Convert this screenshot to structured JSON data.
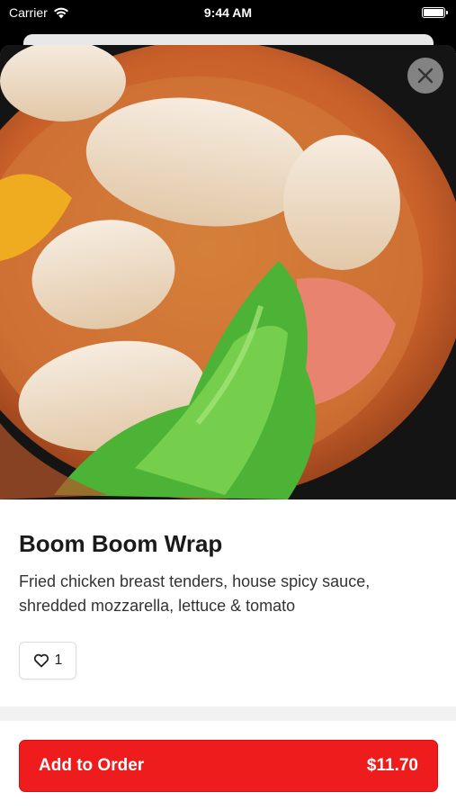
{
  "status_bar": {
    "carrier": "Carrier",
    "time": "9:44 AM"
  },
  "item": {
    "name": "Boom Boom Wrap",
    "description": "Fried chicken breast tenders, house spicy sauce, shredded mozzarella, lettuce & tomato",
    "likes": "1"
  },
  "order_button": {
    "label": "Add to Order",
    "price": "$11.70"
  },
  "colors": {
    "accent": "#ee1c1c",
    "background": "#ffffff"
  },
  "icons": {
    "close": "close-icon",
    "like": "heart-icon",
    "wifi": "wifi-icon",
    "battery": "battery-icon"
  }
}
